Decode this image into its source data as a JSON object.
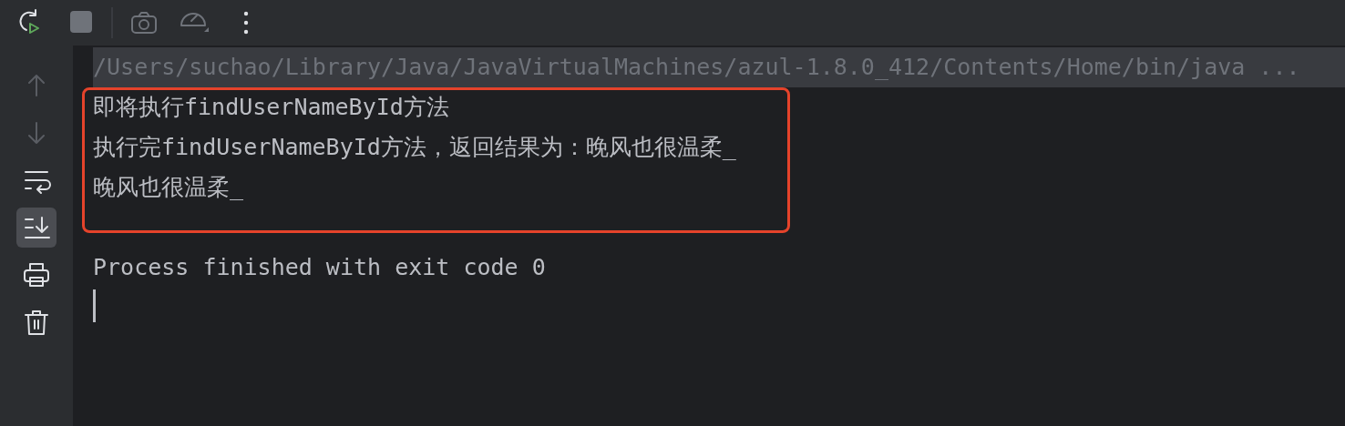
{
  "toolbar": {
    "buttons": [
      {
        "kind": "rerun",
        "disabled": false
      },
      {
        "kind": "stop",
        "disabled": true
      },
      {
        "kind": "separator"
      },
      {
        "kind": "camera",
        "disabled": true
      },
      {
        "kind": "gauge",
        "disabled": true
      },
      {
        "kind": "more",
        "disabled": false
      }
    ]
  },
  "sidebar": {
    "buttons": [
      {
        "kind": "up",
        "disabled": true,
        "selected": false
      },
      {
        "kind": "down",
        "disabled": true,
        "selected": false
      },
      {
        "kind": "wrap",
        "disabled": false,
        "selected": false
      },
      {
        "kind": "scroll-end",
        "disabled": false,
        "selected": true
      },
      {
        "kind": "print",
        "disabled": false,
        "selected": false
      },
      {
        "kind": "trash",
        "disabled": false,
        "selected": false
      }
    ]
  },
  "console": {
    "command": "/Users/suchao/Library/Java/JavaVirtualMachines/azul-1.8.0_412/Contents/Home/bin/java ...",
    "highlighted_lines": [
      "即将执行findUserNameById方法",
      "执行完findUserNameById方法，返回结果为：晚风也很温柔_",
      "晚风也很温柔_"
    ],
    "lines": [
      "Process finished with exit code 0"
    ],
    "cursor": true
  }
}
